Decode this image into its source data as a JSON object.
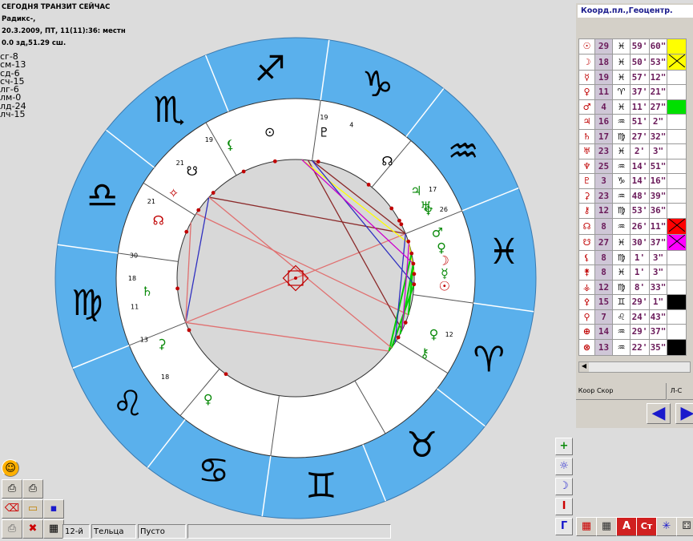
{
  "header": {
    "line1": "СЕГОДНЯ ТРАНЗИТ СЕЙЧАС",
    "line2": "Радикс-,",
    "line3": "20.3.2009, ПТ, 11(11):36: местн",
    "line4": "0.0 зд,51.29 сш."
  },
  "aspect_counts": [
    {
      "label": "сг-8"
    },
    {
      "label": "см-13"
    },
    {
      "label": "сд-6"
    },
    {
      "label": "сч-15"
    },
    {
      "label": "лг-6"
    },
    {
      "label": "лм-0"
    },
    {
      "label": "лд-24"
    },
    {
      "label": "лч-15"
    }
  ],
  "panel": {
    "title": "Коорд.пл.,Геоцентр.",
    "rows": [
      {
        "glyph": "☉",
        "deg": "29",
        "sign": "♓",
        "min": "59'",
        "sec": "60\"",
        "swatch": "#ffff00"
      },
      {
        "glyph": "☽",
        "deg": "18",
        "sign": "♓",
        "min": "50'",
        "sec": "53\"",
        "swatch": "#ffff00",
        "cross": true
      },
      {
        "glyph": "☿",
        "deg": "19",
        "sign": "♓",
        "min": "57'",
        "sec": "12\"",
        "swatch": "#ffffff"
      },
      {
        "glyph": "♀",
        "deg": "11",
        "sign": "♈",
        "min": "37'",
        "sec": "21\"",
        "swatch": "#ffffff"
      },
      {
        "glyph": "♂",
        "deg": "4",
        "sign": "♓",
        "min": "11'",
        "sec": "27\"",
        "swatch": "#00e000"
      },
      {
        "glyph": "♃",
        "deg": "16",
        "sign": "♒",
        "min": "51'",
        "sec": "2\"",
        "swatch": "#ffffff"
      },
      {
        "glyph": "♄",
        "deg": "17",
        "sign": "♍",
        "min": "27'",
        "sec": "32\"",
        "swatch": "#ffffff"
      },
      {
        "glyph": "♅",
        "deg": "23",
        "sign": "♓",
        "min": "2'",
        "sec": "3\"",
        "swatch": "#ffffff"
      },
      {
        "glyph": "♆",
        "deg": "25",
        "sign": "♒",
        "min": "14'",
        "sec": "51\"",
        "swatch": "#ffffff"
      },
      {
        "glyph": "♇",
        "deg": "3",
        "sign": "♑",
        "min": "14'",
        "sec": "16\"",
        "swatch": "#ffffff"
      },
      {
        "glyph": "⚳",
        "deg": "23",
        "sign": "♒",
        "min": "48'",
        "sec": "39\"",
        "swatch": "#ffffff"
      },
      {
        "glyph": "⚷",
        "deg": "12",
        "sign": "♍",
        "min": "53'",
        "sec": "36\"",
        "swatch": "#ffffff"
      },
      {
        "glyph": "☊",
        "deg": "8",
        "sign": "♒",
        "min": "26'",
        "sec": "11\"",
        "swatch": "#ff0000",
        "cross": true
      },
      {
        "glyph": "☋",
        "deg": "27",
        "sign": "♓",
        "min": "30'",
        "sec": "37\"",
        "swatch": "#ff00ff",
        "cross": true
      },
      {
        "glyph": "⚸",
        "deg": "8",
        "sign": "♍",
        "min": "1'",
        "sec": "3\"",
        "swatch": "#ffffff"
      },
      {
        "glyph": "⚵",
        "deg": "8",
        "sign": "♓",
        "min": "1'",
        "sec": "3\"",
        "swatch": "#ffffff"
      },
      {
        "glyph": "⚶",
        "deg": "12",
        "sign": "♍",
        "min": "8'",
        "sec": "33\"",
        "swatch": "#ffffff"
      },
      {
        "glyph": "⚴",
        "deg": "15",
        "sign": "♊",
        "min": "29'",
        "sec": "1\"",
        "swatch": "#000000"
      },
      {
        "glyph": "⚲",
        "deg": "7",
        "sign": "♌",
        "min": "24'",
        "sec": "43\"",
        "swatch": "#ffffff"
      },
      {
        "glyph": "⊕",
        "deg": "14",
        "sign": "♒",
        "min": "29'",
        "sec": "37\"",
        "swatch": "#ffffff"
      },
      {
        "glyph": "⊗",
        "deg": "13",
        "sign": "♒",
        "min": "22'",
        "sec": "35\"",
        "swatch": "#000000",
        "cross": true
      }
    ],
    "tabs": [
      {
        "label": "Коор"
      },
      {
        "label": "Скор"
      },
      {
        "label": ""
      },
      {
        "label": ""
      },
      {
        "label": ""
      },
      {
        "label": "Л-С"
      },
      {
        "label": ""
      }
    ],
    "nav_prev": "◀",
    "nav_next": "▶"
  },
  "chart_tools": {
    "add": "+",
    "sun": "☼",
    "moon": "☽",
    "info": "I",
    "geo": "Г"
  },
  "toolbar": {
    "table1": "▦",
    "table2": "▦",
    "aspects": "A",
    "st": "Ст",
    "star": "✳",
    "dice": "⚃"
  },
  "left_tools": {
    "emoji": "☺",
    "print1": "⎙",
    "print2": "⎙",
    "erase": "⌫",
    "open": "▭",
    "save": "▪",
    "print3": "⎙",
    "close": "✖",
    "calc": "▦"
  },
  "status": {
    "house": "12-й",
    "sign": "Тельца",
    "note": "Пусто"
  },
  "chart_data": {
    "type": "natal-wheel",
    "zodiac_ring_color": "#5ab0ec",
    "signs": [
      "Aries",
      "Taurus",
      "Gemini",
      "Cancer",
      "Leo",
      "Virgo",
      "Libra",
      "Scorpio",
      "Sagittarius",
      "Capricorn",
      "Aquarius",
      "Pisces"
    ],
    "house_cusp_labels": [
      "4",
      "19",
      "17",
      "26",
      "21",
      "30",
      "12",
      "11",
      "18",
      "18",
      "13",
      "21",
      "19"
    ],
    "aspect_line_colors": [
      "#e07070",
      "#8b2a2a",
      "#ffff00",
      "#00cc00",
      "#3030c0",
      "#cc00cc"
    ]
  }
}
